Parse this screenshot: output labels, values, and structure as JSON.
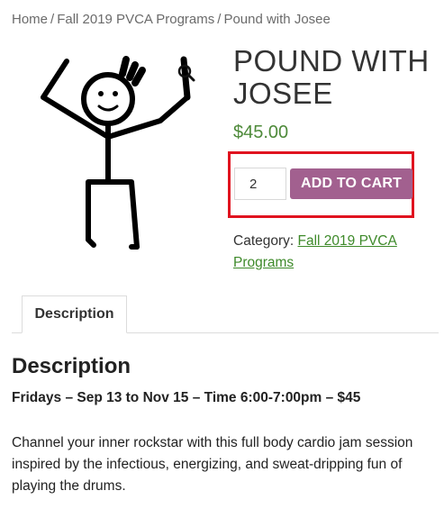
{
  "breadcrumb": {
    "home": "Home",
    "category": "Fall 2019 PVCA Programs",
    "current": "Pound with Josee",
    "separator": "/"
  },
  "product": {
    "title": "POUND WITH JOSEE",
    "price": "$45.00",
    "quantity": "2",
    "add_to_cart_label": "ADD TO CART",
    "category_label": "Category:",
    "category_link": "Fall 2019 PVCA Programs",
    "image_icon": "stick-figure-drummer",
    "zoom_icon": "magnifier-icon"
  },
  "tabs": [
    {
      "label": "Description",
      "active": true
    }
  ],
  "description": {
    "heading": "Description",
    "dates": "Fridays – Sep 13 to Nov 15 – Time 6:00-7:00pm –  $45",
    "body": "Channel your inner rockstar with this full body cardio jam session inspired by the infectious, energizing, and sweat-dripping fun of playing the drums."
  },
  "colors": {
    "price": "#4e8a3a",
    "button": "#a2608f",
    "highlight": "#e0131f",
    "link": "#3e8a2a"
  }
}
